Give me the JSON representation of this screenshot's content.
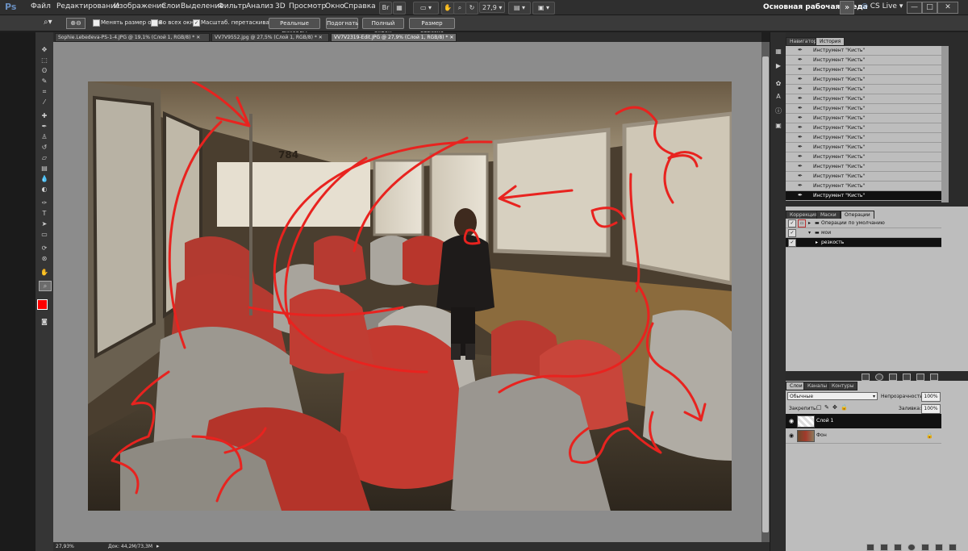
{
  "app": {
    "logo": "Ps"
  },
  "menu": [
    "Файл",
    "Редактирование",
    "Изображение",
    "Слои",
    "Выделение",
    "Фильтр",
    "Анализ",
    "3D",
    "Просмотр",
    "Окно",
    "Справка"
  ],
  "menu_controls": {
    "zoom_value": "27,9"
  },
  "workspace": {
    "label": "Основная рабочая среда",
    "arrow": "»",
    "cslive": "CS Live"
  },
  "window_buttons": [
    "—",
    "□",
    "✕"
  ],
  "options_bar": {
    "checks": [
      {
        "label": "Менять размер окон",
        "checked": false
      },
      {
        "label": "Во всех окнах",
        "checked": false
      },
      {
        "label": "Масштаб. перетаскиванием",
        "checked": true
      }
    ],
    "buttons": [
      "Реальные пикселы",
      "Подогнать",
      "Полный экран",
      "Размер оттиска"
    ]
  },
  "tabs": [
    {
      "label": "Sophie.Lebedeva-PS-1-4.JPG @ 19,1% (Слой 1, RGB/8) *",
      "active": false
    },
    {
      "label": "VV7V9552.jpg @ 27,5% (Слой 1, RGB/8) *",
      "active": false
    },
    {
      "label": "VV7V2319-Edit.JPG @ 27,9% (Слой 1, RGB/8) *",
      "active": true
    }
  ],
  "photo": {
    "seat_number": "784"
  },
  "colors": {
    "foreground": "#ff0000",
    "background": "#ffffff",
    "annotation": "#e8231f"
  },
  "status": {
    "zoom": "27,93%",
    "doc": "Док: 44,2M/73,3M"
  },
  "history_panel": {
    "tabs": [
      "Навигатор",
      "История"
    ],
    "items": [
      "Инструмент \"Кисть\"",
      "Инструмент \"Кисть\"",
      "Инструмент \"Кисть\"",
      "Инструмент \"Кисть\"",
      "Инструмент \"Кисть\"",
      "Инструмент \"Кисть\"",
      "Инструмент \"Кисть\"",
      "Инструмент \"Кисть\"",
      "Инструмент \"Кисть\"",
      "Инструмент \"Кисть\"",
      "Инструмент \"Кисть\"",
      "Инструмент \"Кисть\"",
      "Инструмент \"Кисть\"",
      "Инструмент \"Кисть\"",
      "Инструмент \"Кисть\"",
      "Инструмент \"Кисть\""
    ]
  },
  "actions_panel": {
    "tabs": [
      "Коррекция",
      "Маски",
      "Операции"
    ],
    "items": [
      {
        "label": "Операции по умолчанию",
        "selected": false
      },
      {
        "label": "мои",
        "selected": false
      },
      {
        "label": "резкость",
        "selected": true
      }
    ]
  },
  "layers_panel": {
    "tabs": [
      "Слои",
      "Каналы",
      "Контуры"
    ],
    "blend_mode": "Обычные",
    "opacity_label": "Непрозрачность:",
    "opacity_value": "100%",
    "lock_label": "Закрепить:",
    "fill_label": "Заливка:",
    "fill_value": "100%",
    "layers": [
      {
        "name": "Слой 1",
        "selected": true
      },
      {
        "name": "Фон",
        "selected": false
      }
    ]
  }
}
